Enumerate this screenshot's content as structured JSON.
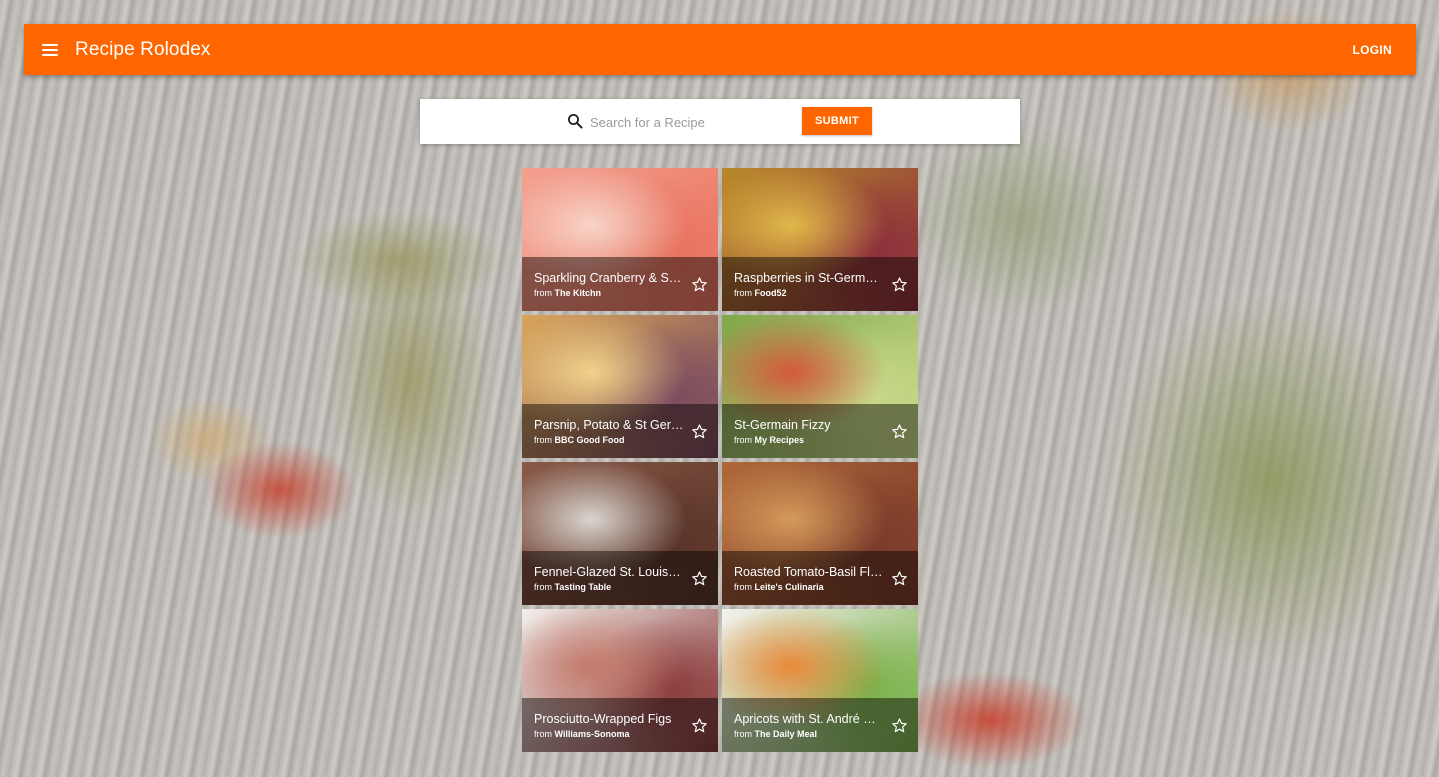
{
  "app_bar": {
    "title": "Recipe Rolodex",
    "login_label": "LOGIN",
    "menu_icon": "menu-icon",
    "color": "#ff6600"
  },
  "search": {
    "placeholder": "Search for a Recipe",
    "value": "",
    "submit_label": "SUBMIT",
    "icon": "search-icon"
  },
  "recipes": [
    {
      "title": "Sparkling Cranberry & St-Germain Punch",
      "from": "from",
      "source": "The Kitchn",
      "colors": [
        "#f4a08f",
        "#e8735f",
        "#f7d4c8"
      ]
    },
    {
      "title": "Raspberries in St-Germain Clafoutis",
      "from": "from",
      "source": "Food52",
      "colors": [
        "#b8892a",
        "#8c2f3c",
        "#e0b84a"
      ]
    },
    {
      "title": "Parsnip, Potato & St Germain Gratin",
      "from": "from",
      "source": "BBC Good Food",
      "colors": [
        "#d9a55a",
        "#7a4a5e",
        "#f0d28a"
      ]
    },
    {
      "title": "St-Germain Fizzy",
      "from": "from",
      "source": "My Recipes",
      "colors": [
        "#7fa84a",
        "#c9d98a",
        "#d45a3a"
      ]
    },
    {
      "title": "Fennel-Glazed St. Louis Ribs",
      "from": "from",
      "source": "Tasting Table",
      "colors": [
        "#8a5a48",
        "#5a3428",
        "#d8d4cf"
      ]
    },
    {
      "title": "Roasted Tomato-Basil Flatbread",
      "from": "from",
      "source": "Leite's Culinaria",
      "colors": [
        "#b0683a",
        "#7a3a2a",
        "#d49a5a"
      ]
    },
    {
      "title": "Prosciutto-Wrapped Figs",
      "from": "from",
      "source": "Williams-Sonoma",
      "colors": [
        "#f2efec",
        "#8a3a3a",
        "#c47a6a"
      ]
    },
    {
      "title": "Apricots with St. André Cheese",
      "from": "from",
      "source": "The Daily Meal",
      "colors": [
        "#f4f2ee",
        "#7ab04a",
        "#e88a3a"
      ]
    }
  ]
}
